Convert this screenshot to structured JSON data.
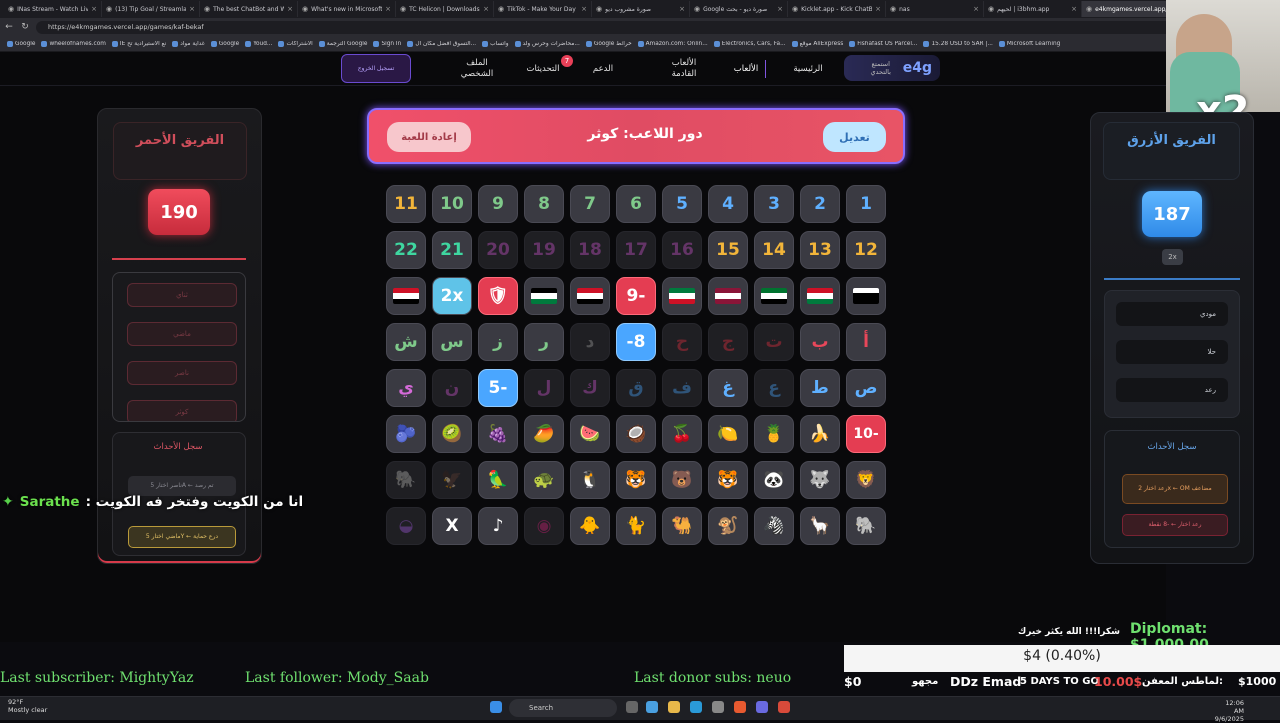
{
  "browser": {
    "tabs": [
      {
        "label": "INas Stream - Watch Live"
      },
      {
        "label": "(13) Tip Goal / Streamlabs"
      },
      {
        "label": "The best ChatBot and W..."
      },
      {
        "label": "What's new in Microsoft..."
      },
      {
        "label": "TC Helicon | Downloads"
      },
      {
        "label": "TikTok - Make Your Day"
      },
      {
        "label": "صورة مشروب ديو"
      },
      {
        "label": "Google صورة ديو - بحث"
      },
      {
        "label": "Kicklet.app - Kick ChatB..."
      },
      {
        "label": "nas"
      },
      {
        "label": "لحيهم | i3bhm.app"
      },
      {
        "label": "e4kmgames.vercel.app/..."
      }
    ],
    "url": "https://e4kmgames.vercel.app/games/kaf-bekaf",
    "bookmarks": [
      "Google",
      "wheelofnames.com",
      "IE نع الاستيرادية تح",
      "غداية مواد",
      "Google",
      "Youd...",
      "الاشتراكات",
      "الترجمة Google",
      "Sign In",
      "التسوق افضل مكان ال...",
      "واتساب",
      "محاضرات وحرس ولد...",
      "Google خرائط",
      "Amazon.com: Onlin...",
      "Electronics, Cars, Fa...",
      "موقع AliExpress",
      "Fishafast US Parcel...",
      "15.28 USD to SAR |...",
      "Microsoft Learning"
    ]
  },
  "nav": {
    "logo": "e4g",
    "logo_sub": "استمتع بالتحدي",
    "home": "الرئيسية",
    "games": "الألعاب",
    "old_games": "الألعاب القادمة",
    "support": "الدعم",
    "updates": "التحديثات",
    "updates_badge": "7",
    "profile": "الملف الشخصي",
    "login": "تسجيل الخروج"
  },
  "game": {
    "reset_label": "إعادة اللعبة",
    "turn_label": "دور اللاعب: كوثر",
    "edit_label": "تعديل",
    "red_team": {
      "name": "الفريق الأحمر",
      "score": "190",
      "players": [
        "ثناي",
        "ماضي",
        "ناصر",
        "كوثر"
      ],
      "log_title": "سجل الأحداث",
      "log": [
        "ناصر اختار 5A ← تم رصد",
        "ماضي اختار 5Y ← درع حماية"
      ]
    },
    "blue_team": {
      "name": "الفريق الأزرق",
      "score": "187",
      "multiplier": "2x",
      "players": [
        "مودي",
        "حلا",
        "رعد"
      ],
      "log_title": "سجل الأحداث",
      "log": [
        "رعد اختار 2x ← OM مضاعف",
        "رعد اختار ← -8 نقطة"
      ]
    },
    "rows": [
      [
        {
          "t": "1",
          "c": "#5fb0ff"
        },
        {
          "t": "2",
          "c": "#5fb0ff"
        },
        {
          "t": "3",
          "c": "#5fb0ff"
        },
        {
          "t": "4",
          "c": "#5fb0ff"
        },
        {
          "t": "5",
          "c": "#5fb0ff"
        },
        {
          "t": "6",
          "c": "#7fc98a"
        },
        {
          "t": "7",
          "c": "#7fc98a"
        },
        {
          "t": "8",
          "c": "#7fc98a"
        },
        {
          "t": "9",
          "c": "#7fc98a"
        },
        {
          "t": "10",
          "c": "#7fc98a"
        },
        {
          "t": "11",
          "c": "#f2b53a"
        }
      ],
      [
        {
          "t": "12",
          "c": "#f2b53a"
        },
        {
          "t": "13",
          "c": "#f2b53a"
        },
        {
          "t": "14",
          "c": "#f2b53a"
        },
        {
          "t": "15",
          "c": "#f2b53a"
        },
        {
          "t": "16",
          "c": "#d46ad8",
          "dim": true
        },
        {
          "t": "17",
          "c": "#d46ad8",
          "dim": true
        },
        {
          "t": "18",
          "c": "#d46ad8",
          "dim": true
        },
        {
          "t": "19",
          "c": "#d46ad8",
          "dim": true
        },
        {
          "t": "20",
          "c": "#d46ad8",
          "dim": true
        },
        {
          "t": "21",
          "c": "#3fd6a0"
        },
        {
          "t": "22",
          "c": "#3fd6a0"
        }
      ],
      [
        {
          "flag": [
            "#fff",
            "#000",
            "#000"
          ],
          "mid": "#ce1126",
          "top": "#ce1126"
        },
        {
          "flag": [
            "#ce1126",
            "#fff",
            "#007a3d"
          ]
        },
        {
          "flag": [
            "#00732f",
            "#fff",
            "#000"
          ],
          "side": "#ff0000"
        },
        {
          "flag": [
            "#8a1538",
            "#fff",
            "#8a1538"
          ]
        },
        {
          "flag": [
            "#007a3d",
            "#fff",
            "#ce1126"
          ],
          "side": "#000"
        },
        {
          "t": "9-",
          "c": "#fff",
          "style": "red"
        },
        {
          "flag": [
            "#ce1126",
            "#fff",
            "#000"
          ]
        },
        {
          "flag": [
            "#000",
            "#fff",
            "#007a3d"
          ],
          "side": "#ce1126"
        },
        {
          "t": "🛡",
          "style": "red",
          "c": "#fff"
        },
        {
          "t": "2x",
          "style": "teal",
          "c": "#fff"
        },
        {
          "flag": [
            "#ce1126",
            "#fff",
            "#000"
          ]
        },
        {
          "flag": [
            "#fff",
            "#ce1126",
            "#ce1126"
          ]
        }
      ],
      [
        {
          "t": "أ",
          "c": "#e8475a"
        },
        {
          "t": "ب",
          "c": "#e8475a"
        },
        {
          "t": "ت",
          "c": "#e8475a",
          "dim": true
        },
        {
          "t": "ج",
          "c": "#e8475a",
          "dim": true
        },
        {
          "t": "ح",
          "c": "#e8475a",
          "dim": true
        },
        {
          "t": "-8",
          "style": "blue",
          "c": "#fff"
        },
        {
          "t": "د",
          "c": "#aaa",
          "dim": true
        },
        {
          "t": "ر",
          "c": "#7fc98a"
        },
        {
          "t": "ز",
          "c": "#7fc98a"
        },
        {
          "t": "س",
          "c": "#7fc98a"
        },
        {
          "t": "ش",
          "c": "#7fc98a"
        }
      ],
      [
        {
          "t": "ص",
          "c": "#5fb0ff"
        },
        {
          "t": "ط",
          "c": "#5fb0ff"
        },
        {
          "t": "ع",
          "c": "#5fb0ff",
          "dim": true
        },
        {
          "t": "غ",
          "c": "#5fb0ff"
        },
        {
          "t": "ف",
          "c": "#5fb0ff",
          "dim": true
        },
        {
          "t": "ق",
          "c": "#5fb0ff",
          "dim": true
        },
        {
          "t": "ك",
          "c": "#d46ad8",
          "dim": true
        },
        {
          "t": "ل",
          "c": "#d46ad8",
          "dim": true
        },
        {
          "t": "5-",
          "style": "blue",
          "c": "#fff"
        },
        {
          "t": "ن",
          "c": "#d46ad8",
          "dim": true
        },
        {
          "t": "ي",
          "c": "#d46ad8"
        }
      ],
      [
        {
          "t": "10-",
          "style": "red",
          "c": "#fff"
        },
        {
          "t": "🍌"
        },
        {
          "t": "🍍"
        },
        {
          "t": "🍋"
        },
        {
          "t": "🍒"
        },
        {
          "t": "🥥"
        },
        {
          "t": "🍉"
        },
        {
          "t": "🥭"
        },
        {
          "t": "🍇"
        },
        {
          "t": "🥝"
        },
        {
          "t": "🫐"
        }
      ],
      [
        {
          "t": "🦁"
        },
        {
          "t": "🐺"
        },
        {
          "t": "🐼"
        },
        {
          "t": "🐯"
        },
        {
          "t": "🐻"
        },
        {
          "t": "🐯"
        },
        {
          "t": "🐧"
        },
        {
          "t": "🐢"
        },
        {
          "t": "🦜"
        },
        {
          "t": "🦅",
          "dim": true
        },
        {
          "t": "🐘",
          "dim": true
        }
      ],
      [
        {
          "t": "🐘"
        },
        {
          "t": "🦙"
        },
        {
          "t": "🦓"
        },
        {
          "t": "🐒"
        },
        {
          "t": "🐫"
        },
        {
          "t": "🐈"
        },
        {
          "t": "🐥"
        },
        {
          "t": "◉",
          "c": "#d83a8a",
          "dim": true
        },
        {
          "t": "♪",
          "c": "#fff"
        },
        {
          "t": "X",
          "c": "#fff"
        },
        {
          "t": "◒",
          "c": "#a86be0",
          "dim": true
        }
      ]
    ]
  },
  "overlay": {
    "chat_user": "Sarathe",
    "chat_text": ": انا من الكويت وفتخر فه الكويت",
    "cam_badge": "x2",
    "last_subscriber": "Last subscriber: MightyYaz",
    "last_follower": "Last follower: Mody_Saab",
    "last_donor": "Last donor subs: neuo",
    "thanks": "شكرا!!! الله يكثر خيرك",
    "diplomat": "Diplomat: $1,000.00",
    "donation": "$4 (0.40%)",
    "goal_min": "$0",
    "goal_name": "مجهو",
    "goal_user": "DDz Emad",
    "goal_days": "5 DAYS TO GO",
    "goal_amount": "10.00$",
    "goal_label": "لماطس المعفن:",
    "goal_max": "$1000"
  },
  "taskbar": {
    "weather_temp": "92°F",
    "weather_desc": "Mostly clear",
    "search": "Search",
    "time": "12:06 AM",
    "date": "9/6/2025"
  }
}
